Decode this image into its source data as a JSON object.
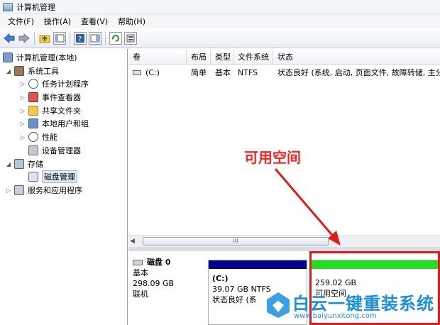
{
  "window": {
    "title": "计算机管理"
  },
  "menu": [
    "文件(F)",
    "操作(A)",
    "查看(V)",
    "帮助(H)"
  ],
  "toolbar": {
    "icons": [
      "back-arrow-icon",
      "forward-arrow-icon",
      "up-folder-icon",
      "show-hide-tree-icon",
      "help-icon",
      "properties-icon",
      "refresh-icon",
      "export-icon"
    ]
  },
  "tree": {
    "root": "计算机管理(本地)",
    "system_tools": "系统工具",
    "task_scheduler": "任务计划程序",
    "event_viewer": "事件查看器",
    "shared_folders": "共享文件夹",
    "local_users": "本地用户和组",
    "performance": "性能",
    "device_manager": "设备管理器",
    "storage": "存储",
    "disk_management": "磁盘管理",
    "services_apps": "服务和应用程序"
  },
  "volume_table": {
    "columns": [
      "卷",
      "布局",
      "类型",
      "文件系统",
      "状态"
    ],
    "rows": [
      {
        "volume": "(C:)",
        "layout": "简单",
        "type": "基本",
        "fs": "NTFS",
        "status": "状态良好 (系统, 启动, 页面文件, 故障转储, 主分"
      }
    ]
  },
  "scroll": {
    "thumb_glyph": "III"
  },
  "disk0": {
    "name": "磁盘 0",
    "kind": "基本",
    "size": "298.09 GB",
    "state": "联机",
    "partition_c": {
      "label": "(C:)",
      "size": "39.07 GB NTFS",
      "status": "状态良好 (系"
    },
    "partition_free": {
      "size": "259.02 GB",
      "label": "可用空间"
    }
  },
  "annotation": {
    "text": "可用空间"
  },
  "watermark": {
    "text": "白云一键重装系统",
    "url": "www.baiyunxitong.com"
  },
  "colors": {
    "primary_partition": "#00008b",
    "free_space": "#22dd22",
    "highlight": "#e21a1a",
    "annotation": "#ff2222"
  }
}
